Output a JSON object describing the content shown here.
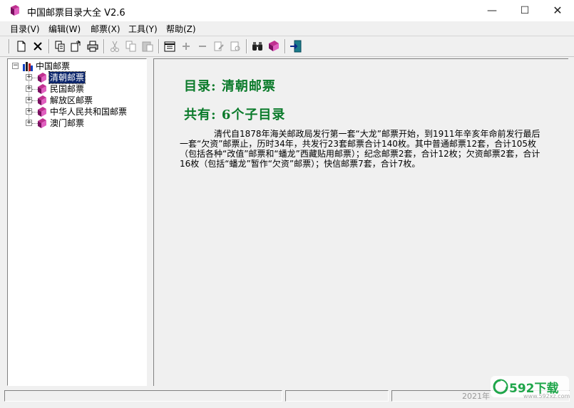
{
  "window": {
    "title": "中国邮票目录大全 V2.6",
    "minimize": "—",
    "maximize": "☐",
    "close": "✕"
  },
  "menu": [
    {
      "label": "目录(V)"
    },
    {
      "label": "编辑(W)"
    },
    {
      "label": "邮票(X)"
    },
    {
      "label": "工具(Y)"
    },
    {
      "label": "帮助(Z)"
    }
  ],
  "toolbar": {
    "icons": [
      "new-icon",
      "delete-icon",
      "copy-entry-icon",
      "paste-entry-icon",
      "print-icon",
      "cut-icon",
      "copy-icon",
      "paste-icon",
      "catalog-icon",
      "add-icon",
      "remove-icon",
      "edit-icon",
      "properties-icon",
      "find-icon",
      "books-icon",
      "exit-icon"
    ]
  },
  "tree": {
    "root": {
      "label": "中国邮票",
      "expander": "−"
    },
    "children": [
      {
        "label": "清朝邮票",
        "expander": "+",
        "selected": true
      },
      {
        "label": "民国邮票",
        "expander": "+"
      },
      {
        "label": "解放区邮票",
        "expander": "+"
      },
      {
        "label": "中华人民共和国邮票",
        "expander": "+"
      },
      {
        "label": "澳门邮票",
        "expander": "+"
      }
    ]
  },
  "content": {
    "catalog_heading": "目录: 清朝邮票",
    "count_heading": "共有: 6个子目录",
    "description": "清代自1878年海关邮政局发行第一套“大龙”邮票开始，到1911年辛亥年命前发行最后一套“欠资”邮票止，历时34年，共发行23套邮票合计140枚。其中普通邮票12套，合计105枚（包括各种“改值”邮票和“蟠龙”西藏贴用邮票）；纪念邮票2套，合计12枚；欠资邮票2套，合计16枚（包括“蟠龙”暂作“欠资”邮票）；快信邮票7套，合计7枚。"
  },
  "watermark": {
    "year": "2021年",
    "brand": "592下载",
    "url": "www.592xz.com"
  },
  "colors": {
    "heading_green": "#0a7a2a",
    "selection": "#0a246a"
  }
}
